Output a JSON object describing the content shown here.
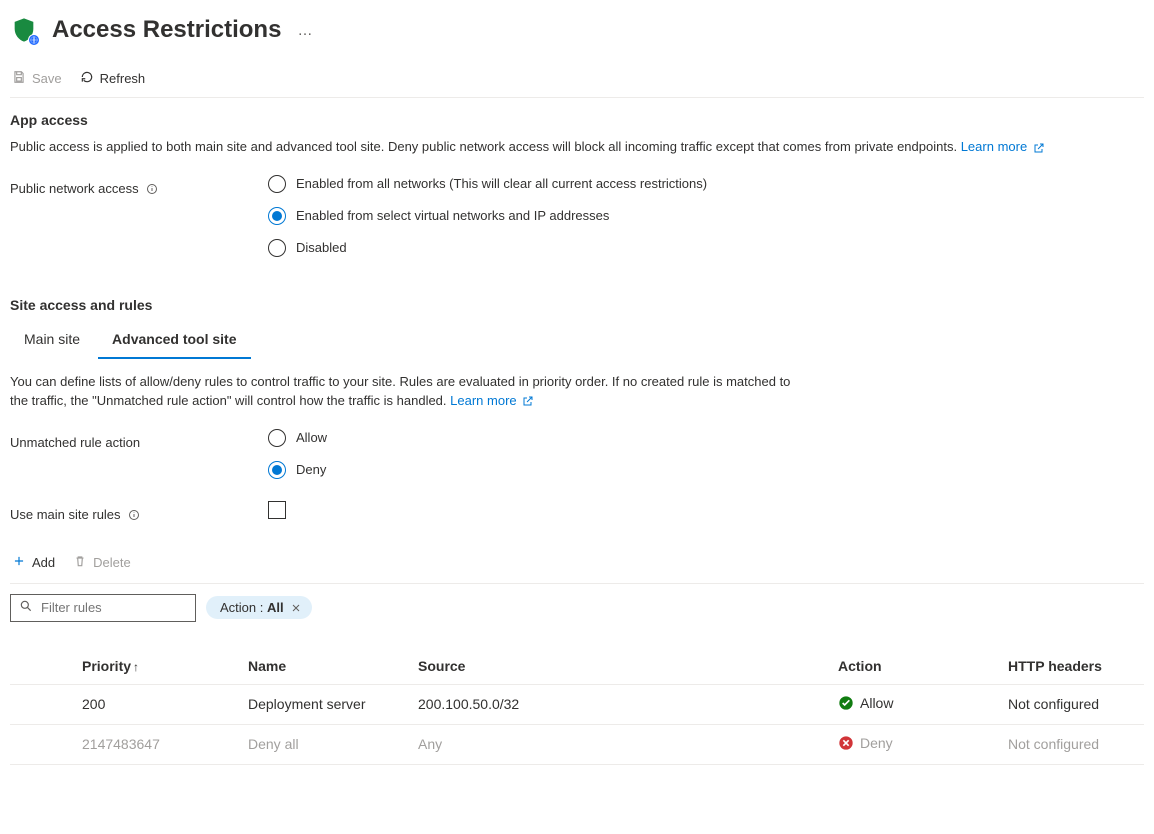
{
  "header": {
    "title": "Access Restrictions",
    "more": "…"
  },
  "toolbar": {
    "save": "Save",
    "refresh": "Refresh"
  },
  "app_access": {
    "title": "App access",
    "desc": "Public access is applied to both main site and advanced tool site. Deny public network access will block all incoming traffic except that comes from private endpoints.",
    "learn_more": "Learn more",
    "public_network_access_label": "Public network access",
    "options": {
      "all": "Enabled from all networks (This will clear all current access restrictions)",
      "select": "Enabled from select virtual networks and IP addresses",
      "disabled": "Disabled"
    }
  },
  "site_access": {
    "title": "Site access and rules",
    "tabs": {
      "main": "Main site",
      "advanced": "Advanced tool site"
    },
    "desc": "You can define lists of allow/deny rules to control traffic to your site. Rules are evaluated in priority order. If no created rule is matched to the traffic, the \"Unmatched rule action\" will control how the traffic is handled.",
    "learn_more": "Learn more",
    "unmatched_label": "Unmatched rule action",
    "unmatched_options": {
      "allow": "Allow",
      "deny": "Deny"
    },
    "use_main_label": "Use main site rules"
  },
  "rules_toolbar": {
    "add": "Add",
    "delete": "Delete",
    "filter_placeholder": "Filter rules",
    "pill_prefix": "Action : ",
    "pill_value": "All"
  },
  "table": {
    "headers": {
      "priority": "Priority",
      "name": "Name",
      "source": "Source",
      "action": "Action",
      "http": "HTTP headers"
    },
    "rows": [
      {
        "priority": "200",
        "name": "Deployment server",
        "source": "200.100.50.0/32",
        "action": "Allow",
        "status": "allow",
        "http": "Not configured"
      },
      {
        "priority": "2147483647",
        "name": "Deny all",
        "source": "Any",
        "action": "Deny",
        "status": "deny",
        "http": "Not configured"
      }
    ]
  }
}
